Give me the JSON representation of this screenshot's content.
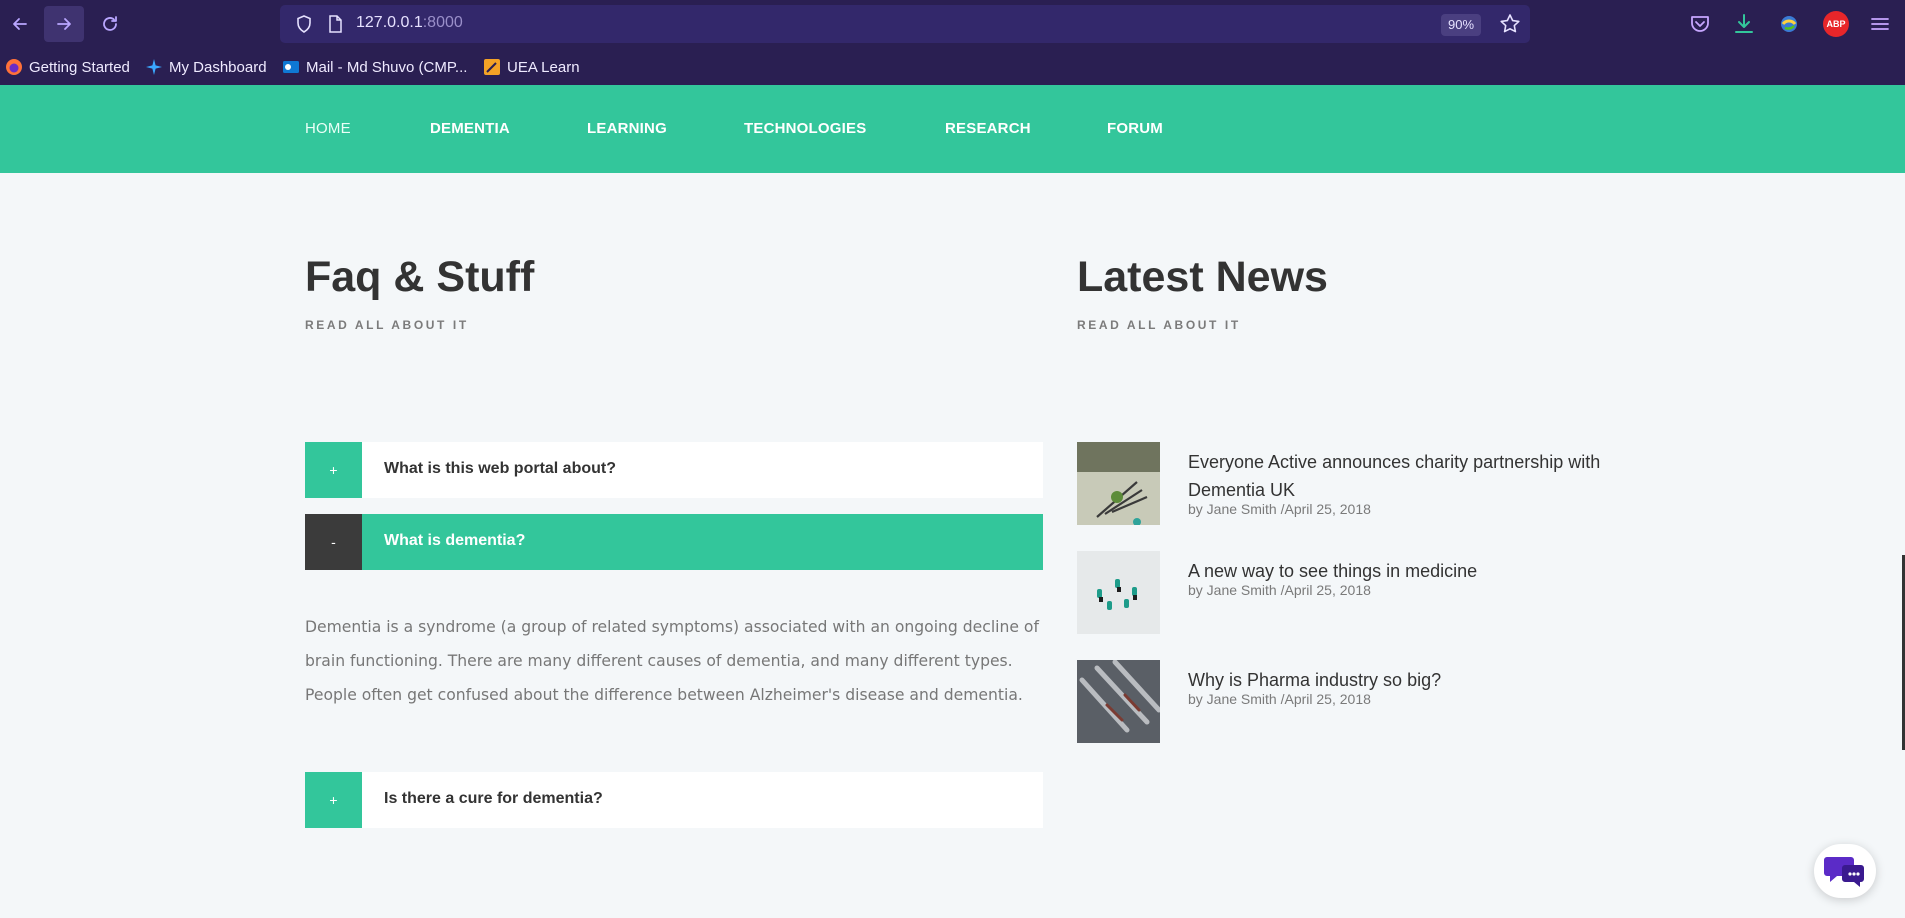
{
  "browser": {
    "url_host": "127.0.0.1",
    "url_port": ":8000",
    "zoom": "90%",
    "bookmarks": [
      {
        "label": "Getting Started",
        "icon": "firefox-icon"
      },
      {
        "label": "My Dashboard",
        "icon": "sparkle-icon"
      },
      {
        "label": "Mail - Md Shuvo (CMP...",
        "icon": "outlook-icon"
      },
      {
        "label": "UEA Learn",
        "icon": "pencil-icon"
      }
    ],
    "abp_label": "ABP"
  },
  "nav": {
    "items": [
      "HOME",
      "DEMENTIA",
      "LEARNING",
      "TECHNOLOGIES",
      "RESEARCH",
      "FORUM"
    ]
  },
  "faq_section": {
    "title": "Faq & Stuff",
    "subtitle": "READ ALL ABOUT IT",
    "items": [
      {
        "toggle": "+",
        "question": "What is this web portal about?",
        "open": false
      },
      {
        "toggle": "-",
        "question": "What is dementia?",
        "open": true
      },
      {
        "toggle": "+",
        "question": "Is there a cure for dementia?",
        "open": false
      }
    ],
    "answer": "Dementia is a syndrome (a group of related symptoms) associated with an ongoing decline of brain functioning. There are many different causes of dementia, and many different types. People often get confused about the difference between Alzheimer's disease and dementia."
  },
  "news_section": {
    "title": "Latest News",
    "subtitle": "READ ALL ABOUT IT",
    "items": [
      {
        "title": "Everyone Active announces charity partnership with Dementia UK",
        "author": "by Jane Smith",
        "date": "/April 25, 2018"
      },
      {
        "title": "A new way to see things in medicine",
        "author": "by Jane Smith",
        "date": "/April 25, 2018"
      },
      {
        "title": "Why is Pharma industry so big?",
        "author": "by Jane Smith",
        "date": "/April 25, 2018"
      }
    ]
  },
  "colors": {
    "accent": "#33c69b",
    "browser_bg": "#2a1f52",
    "dark_toggle": "#3b3b3b"
  }
}
